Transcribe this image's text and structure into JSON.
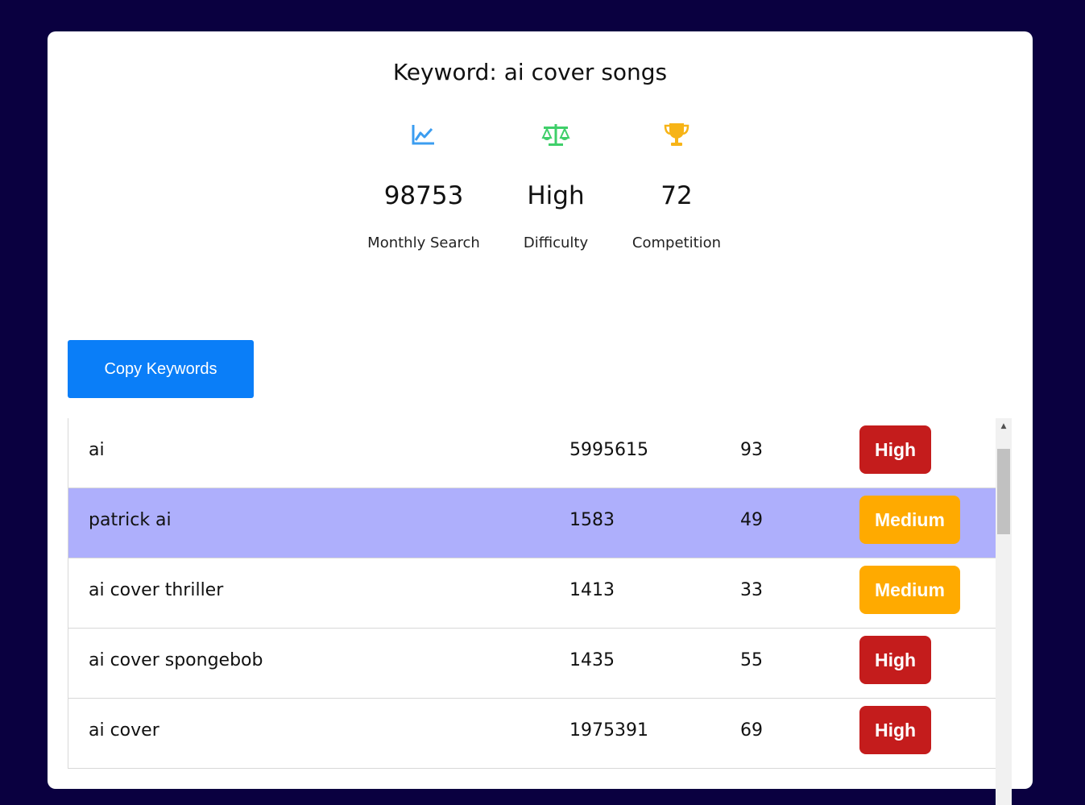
{
  "keyword_title": "Keyword: ai cover songs",
  "stats": [
    {
      "icon": "line-chart-icon",
      "value": "98753",
      "label": "Monthly Search",
      "color": "#3b9df0"
    },
    {
      "icon": "scale-balance-icon",
      "value": "High",
      "label": "Difficulty",
      "color": "#3fcf6a"
    },
    {
      "icon": "trophy-icon",
      "value": "72",
      "label": "Competition",
      "color": "#f7b417"
    }
  ],
  "copy_button_label": "Copy Keywords",
  "rows": [
    {
      "keyword": "ai",
      "volume": "5995615",
      "score": "93",
      "level": "High"
    },
    {
      "keyword": "patrick ai",
      "volume": "1583",
      "score": "49",
      "level": "Medium"
    },
    {
      "keyword": "ai cover thriller",
      "volume": "1413",
      "score": "33",
      "level": "Medium"
    },
    {
      "keyword": "ai cover spongebob",
      "volume": "1435",
      "score": "55",
      "level": "High"
    },
    {
      "keyword": "ai cover",
      "volume": "1975391",
      "score": "69",
      "level": "High"
    }
  ],
  "colors": {
    "background": "#0a0040",
    "primary_button": "#0a7ef8",
    "high_badge": "#c41c1c",
    "medium_badge": "#ffaa00",
    "row_highlight": "#aeaffc"
  }
}
